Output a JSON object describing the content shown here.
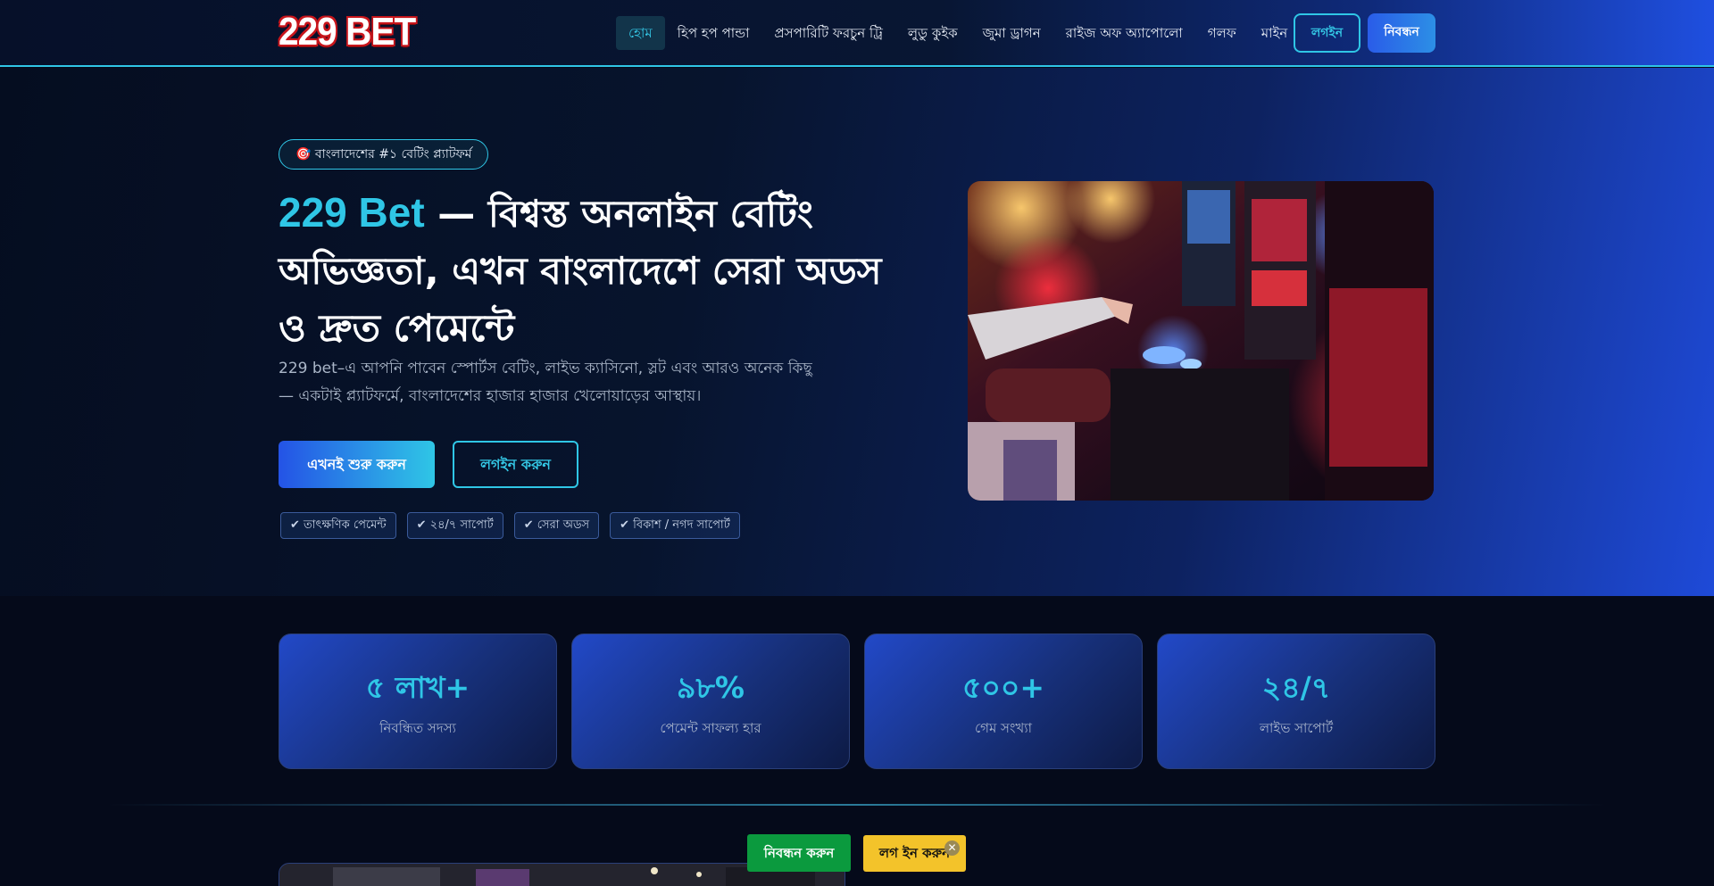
{
  "header": {
    "logo_text": "229 BET",
    "nav": [
      "হোম",
      "হিপ হপ পান্ডা",
      "প্রসপারিটি ফরচুন ট্রি",
      "লুডু কুইক",
      "জুমা ড্রাগন",
      "রাইজ অফ অ্যাপোলো",
      "গলফ",
      "মাইন"
    ],
    "login_label": "লগইন",
    "register_label": "নিবন্ধন"
  },
  "hero": {
    "badge": "🎯 বাংলাদেশের #১ বেটিং প্ল্যাটফর্ম",
    "title_brand": "229 Bet",
    "title_rest": " — বিশ্বস্ত অনলাইন বেটিং অভিজ্ঞতা, এখন বাংলাদেশে সেরা অডস ও দ্রুত পেমেন্টে",
    "description": "229 bet–এ আপনি পাবেন স্পোর্টস বেটিং, লাইভ ক্যাসিনো, স্লট এবং আরও অনেক কিছু — একটাই প্ল্যাটফর্মে, বাংলাদেশের হাজার হাজার খেলোয়াড়ের আস্থায়।",
    "primary_button": "এখনই শুরু করুন",
    "secondary_button": "লগইন করুন",
    "features": [
      "✔ তাৎক্ষণিক পেমেন্ট",
      "✔ ২৪/৭ সাপোর্ট",
      "✔ সেরা অডস",
      "✔ বিকাশ / নগদ সাপোর্ট"
    ]
  },
  "stats": [
    {
      "value": "৫ লাখ+",
      "label": "নিবন্ধিত সদস্য"
    },
    {
      "value": "৯৮%",
      "label": "পেমেন্ট সাফল্য হার"
    },
    {
      "value": "৫০০+",
      "label": "গেম সংখ্যা"
    },
    {
      "value": "২৪/৭",
      "label": "লাইভ সাপোর্ট"
    }
  ],
  "floating_cta": {
    "register": "নিবন্ধন করুন",
    "login": "লগ ইন করুন",
    "close": "✕"
  },
  "colors": {
    "accent": "#2fc6e6",
    "brand_blue": "#2453e6",
    "register_green": "#0b9a3e",
    "login_yellow": "#f3c32a"
  }
}
